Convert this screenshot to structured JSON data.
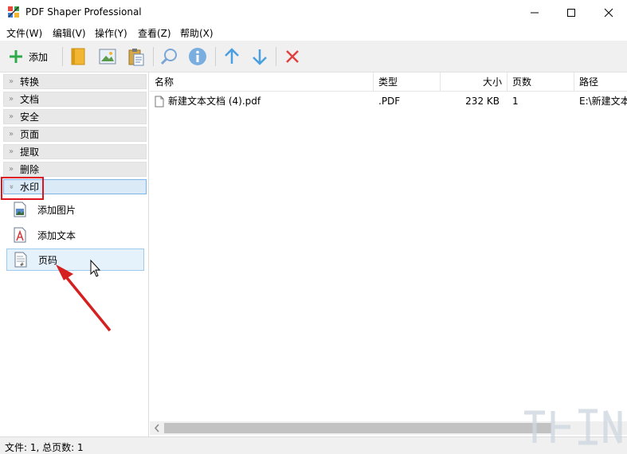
{
  "window": {
    "title": "PDF Shaper Professional",
    "minimize_glyph": "—",
    "maximize_glyph": "☐",
    "close_glyph": "✕"
  },
  "menu": {
    "items": [
      {
        "label": "文件(W)"
      },
      {
        "label": "编辑(V)"
      },
      {
        "label": "操作(Y)"
      },
      {
        "label": "查看(Z)"
      },
      {
        "label": "帮助(X)"
      }
    ]
  },
  "toolbar": {
    "add_label": "添加",
    "icons": [
      "plus-icon",
      "folder-icon",
      "image-icon",
      "clipboard-icon",
      "search-icon",
      "info-icon",
      "arrow-up-icon",
      "arrow-down-icon",
      "remove-icon"
    ]
  },
  "sidebar": {
    "groups": [
      {
        "label": "转换"
      },
      {
        "label": "文档"
      },
      {
        "label": "安全"
      },
      {
        "label": "页面"
      },
      {
        "label": "提取"
      },
      {
        "label": "删除"
      },
      {
        "label": "水印"
      }
    ],
    "watermark_items": [
      {
        "label": "添加图片",
        "icon": "image-watermark-icon"
      },
      {
        "label": "添加文本",
        "icon": "text-watermark-icon"
      },
      {
        "label": "页码",
        "icon": "page-number-icon"
      }
    ]
  },
  "table": {
    "columns": [
      "名称",
      "类型",
      "大小",
      "页数",
      "路径"
    ],
    "rows": [
      {
        "name": "新建文本文档 (4).pdf",
        "type": ".PDF",
        "size": "232 KB",
        "pages": "1",
        "path": "E:\\新建文本"
      }
    ]
  },
  "status": {
    "text": "文件: 1, 总页数: 1"
  },
  "colors": {
    "accent_green": "#2eaa4a",
    "arrow_blue": "#4a9fe0",
    "remove_red": "#e04040",
    "annotation_red": "#e0141e"
  }
}
